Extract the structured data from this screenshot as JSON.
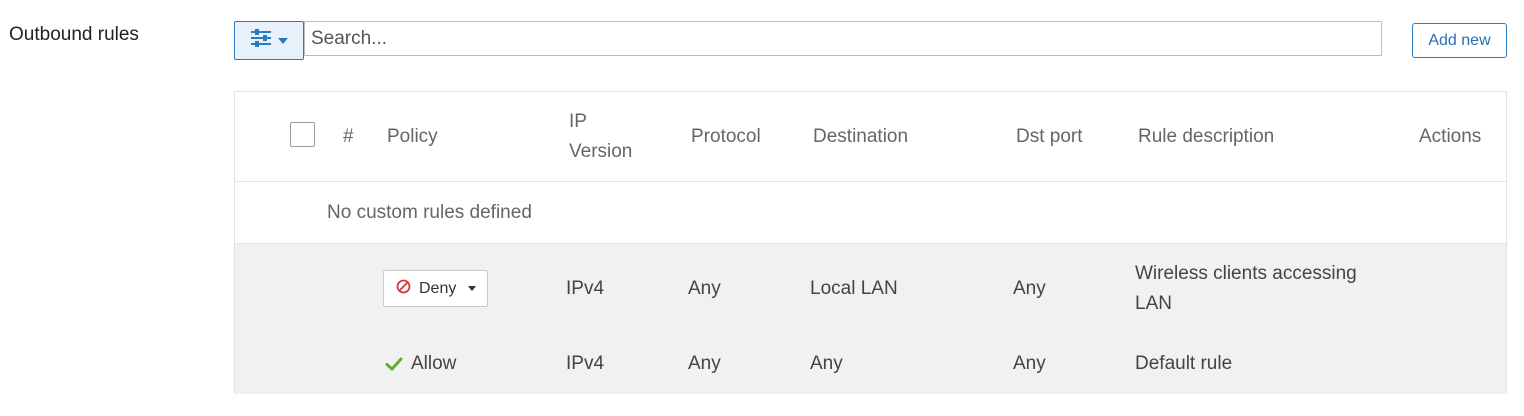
{
  "section": {
    "label": "Outbound rules"
  },
  "toolbar": {
    "filter_icon": "sliders-icon",
    "search_placeholder": "Search...",
    "add_label": "Add new"
  },
  "table": {
    "headers": {
      "number": "#",
      "policy": "Policy",
      "ip_version_line1": "IP",
      "ip_version_line2": "Version",
      "protocol": "Protocol",
      "destination": "Destination",
      "dst_port": "Dst port",
      "description": "Rule description",
      "actions": "Actions"
    },
    "empty_message": "No custom rules defined",
    "default_rules": [
      {
        "policy": "Deny",
        "policy_icon": "deny-icon",
        "ip_version": "IPv4",
        "protocol": "Any",
        "destination": "Local LAN",
        "dst_port": "Any",
        "description_line1": "Wireless clients accessing",
        "description_line2": "LAN"
      },
      {
        "policy": "Allow",
        "policy_icon": "check-icon",
        "ip_version": "IPv4",
        "protocol": "Any",
        "destination": "Any",
        "dst_port": "Any",
        "description": "Default rule"
      }
    ]
  },
  "colors": {
    "accent": "#2a7abf",
    "deny": "#d9363e",
    "allow": "#5cb034",
    "default_row_bg": "#f1f1f1"
  }
}
